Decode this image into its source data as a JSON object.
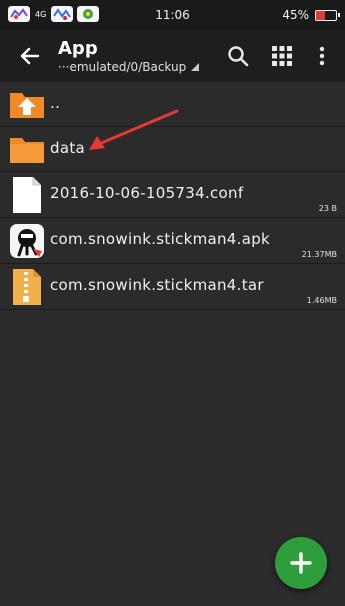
{
  "status_bar": {
    "network": "4G",
    "time": "11:06",
    "battery_percent_text": "45%",
    "battery_level": 0.45
  },
  "toolbar": {
    "title": "App",
    "path": "···emulated/0/Backup"
  },
  "files": [
    {
      "name": "..",
      "type": "parent-folder",
      "size": ""
    },
    {
      "name": "data",
      "type": "folder",
      "size": ""
    },
    {
      "name": "2016-10-06-105734.conf",
      "type": "file",
      "size": "23 B"
    },
    {
      "name": "com.snowink.stickman4.apk",
      "type": "apk",
      "size": "21.37MB"
    },
    {
      "name": "com.snowink.stickman4.tar",
      "type": "archive",
      "size": "1.46MB"
    }
  ],
  "colors": {
    "accent": "#2e9e3c",
    "folder": "#f08a24",
    "annotation": "#e53935"
  },
  "icons": [
    "back-arrow-icon",
    "search-icon",
    "grid-view-icon",
    "more-vert-icon",
    "add-icon"
  ]
}
